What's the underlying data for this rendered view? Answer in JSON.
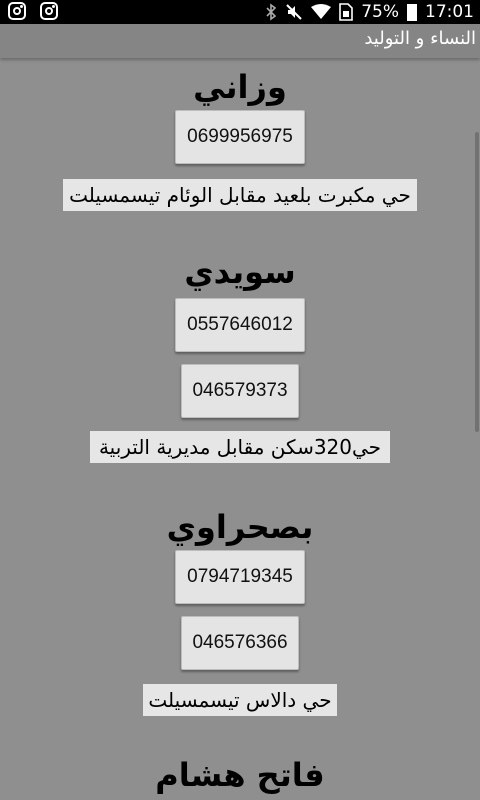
{
  "status_bar": {
    "icons_left": [
      "instagram-icon",
      "instagram-icon"
    ],
    "icons_right": [
      "bluetooth-icon",
      "mute-icon",
      "wifi-icon",
      "sim-icon"
    ],
    "battery": "75%",
    "time": "17:01"
  },
  "app_bar": {
    "title": "النساء و التوليد"
  },
  "doctors": [
    {
      "name": "وزاني",
      "phones": [
        "0699956975"
      ],
      "address": "حي مكبرت بلعيد مقابل الوئام تيسمسيلت"
    },
    {
      "name": "سويدي",
      "phones": [
        "0557646012",
        "046579373"
      ],
      "address": "حي320سكن مقابل مديرية التربية"
    },
    {
      "name": "بصحراوي",
      "phones": [
        "0794719345",
        "046576366"
      ],
      "address": "حي دالاس تيسمسيلت"
    },
    {
      "name": "فاتح هشام"
    }
  ]
}
